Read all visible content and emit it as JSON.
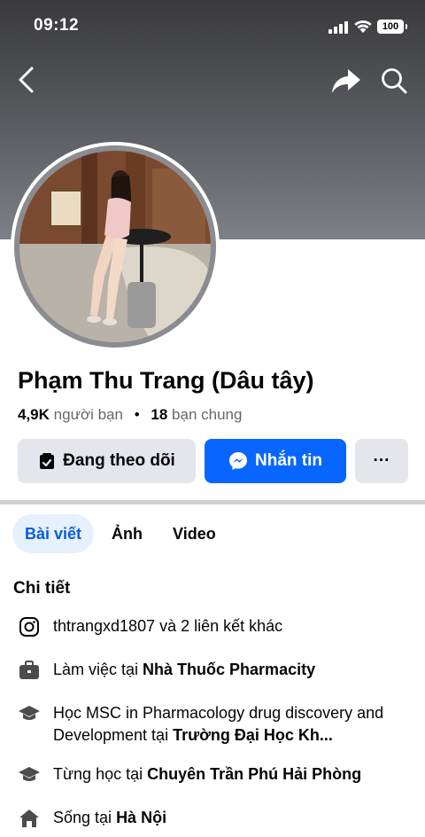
{
  "status": {
    "time": "09:12",
    "battery": "100"
  },
  "profile": {
    "name": "Phạm Thu Trang (Dâu tây)",
    "friends_count": "4,9K",
    "friends_label": "người bạn",
    "mutual_count": "18",
    "mutual_label": "bạn chung"
  },
  "actions": {
    "follow_label": "Đang theo dõi",
    "message_label": "Nhắn tin",
    "more_label": "···"
  },
  "tabs": [
    {
      "label": "Bài viết",
      "active": true
    },
    {
      "label": "Ảnh",
      "active": false
    },
    {
      "label": "Video",
      "active": false
    }
  ],
  "details": {
    "title": "Chi tiết",
    "links": {
      "text": "thtrangxd1807 và 2 liên kết khác",
      "icon": "instagram-icon"
    },
    "work": {
      "prefix": "Làm việc tại ",
      "place": "Nhà Thuốc Pharmacity",
      "icon": "briefcase-icon"
    },
    "study": {
      "prefix": "Học MSC in Pharmacology drug discovery and Development tại ",
      "place": "Trường Đại Học Kh...",
      "icon": "graduation-cap-icon"
    },
    "studied": {
      "prefix": "Từng học tại ",
      "place": "Chuyên Trần Phú Hải Phòng",
      "icon": "graduation-cap-icon"
    },
    "lives": {
      "prefix": "Sống tại ",
      "place": "Hà Nội",
      "icon": "home-icon"
    }
  },
  "colors": {
    "primary_blue": "#0866ff",
    "tab_active_bg": "#e7f0fd",
    "button_grey": "#e4e6eb"
  }
}
